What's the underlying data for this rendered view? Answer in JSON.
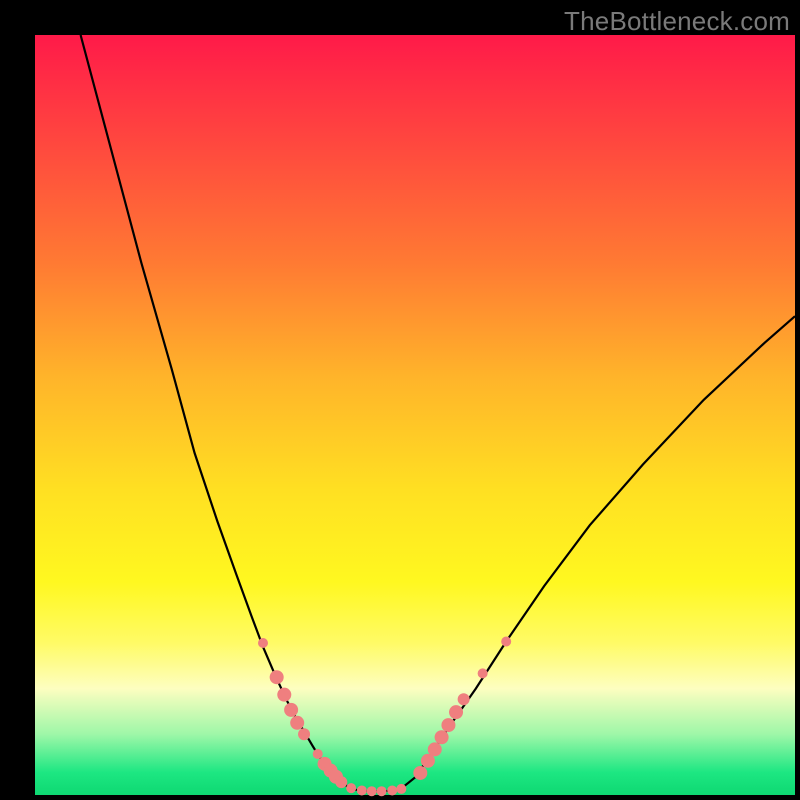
{
  "watermark": "TheBottleneck.com",
  "colors": {
    "dot_fill": "#ef7f7f",
    "curve_stroke": "#000000",
    "frame": "#000000"
  },
  "chart_data": {
    "type": "line",
    "title": "",
    "xlabel": "",
    "ylabel": "",
    "xlim": [
      0,
      100
    ],
    "ylim": [
      0,
      100
    ],
    "curves": [
      {
        "name": "left-branch",
        "x": [
          6,
          10,
          14,
          18,
          21,
          24,
          26.5,
          28.5,
          30,
          31.5,
          33,
          34.3,
          35.5,
          36.5,
          37.3,
          38,
          38.8,
          39.5,
          40.2,
          41,
          42
        ],
        "y": [
          100,
          85,
          70,
          56,
          45,
          36,
          29,
          23.5,
          19.5,
          16,
          12.7,
          10.2,
          8.2,
          6.5,
          5.2,
          4.2,
          3.3,
          2.5,
          1.8,
          1.2,
          0.7
        ]
      },
      {
        "name": "valley",
        "x": [
          42,
          44,
          46,
          48
        ],
        "y": [
          0.7,
          0.5,
          0.5,
          0.7
        ]
      },
      {
        "name": "right-branch",
        "x": [
          48,
          50,
          52,
          54.5,
          58,
          62,
          67,
          73,
          80,
          88,
          96,
          100
        ],
        "y": [
          0.7,
          2.3,
          5.2,
          9.0,
          14.0,
          20.2,
          27.5,
          35.5,
          43.5,
          52.0,
          59.5,
          63.0
        ]
      }
    ],
    "scatter": {
      "name": "dots",
      "points": [
        {
          "x": 30.0,
          "y": 20.0,
          "r": 5
        },
        {
          "x": 31.8,
          "y": 15.5,
          "r": 7
        },
        {
          "x": 32.8,
          "y": 13.2,
          "r": 7
        },
        {
          "x": 33.7,
          "y": 11.2,
          "r": 7
        },
        {
          "x": 34.5,
          "y": 9.5,
          "r": 7
        },
        {
          "x": 35.4,
          "y": 8.0,
          "r": 6
        },
        {
          "x": 37.2,
          "y": 5.4,
          "r": 5
        },
        {
          "x": 38.1,
          "y": 4.1,
          "r": 7
        },
        {
          "x": 38.9,
          "y": 3.2,
          "r": 7
        },
        {
          "x": 39.6,
          "y": 2.4,
          "r": 7
        },
        {
          "x": 40.3,
          "y": 1.7,
          "r": 6
        },
        {
          "x": 41.6,
          "y": 0.9,
          "r": 5
        },
        {
          "x": 43.0,
          "y": 0.6,
          "r": 5
        },
        {
          "x": 44.3,
          "y": 0.5,
          "r": 5
        },
        {
          "x": 45.6,
          "y": 0.5,
          "r": 5
        },
        {
          "x": 47.0,
          "y": 0.6,
          "r": 5
        },
        {
          "x": 48.2,
          "y": 0.8,
          "r": 5
        },
        {
          "x": 50.7,
          "y": 2.9,
          "r": 7
        },
        {
          "x": 51.7,
          "y": 4.5,
          "r": 7
        },
        {
          "x": 52.6,
          "y": 6.0,
          "r": 7
        },
        {
          "x": 53.5,
          "y": 7.6,
          "r": 7
        },
        {
          "x": 54.4,
          "y": 9.2,
          "r": 7
        },
        {
          "x": 55.4,
          "y": 10.9,
          "r": 7
        },
        {
          "x": 56.4,
          "y": 12.6,
          "r": 6
        },
        {
          "x": 58.9,
          "y": 16.0,
          "r": 5
        },
        {
          "x": 62.0,
          "y": 20.2,
          "r": 5
        }
      ]
    }
  }
}
